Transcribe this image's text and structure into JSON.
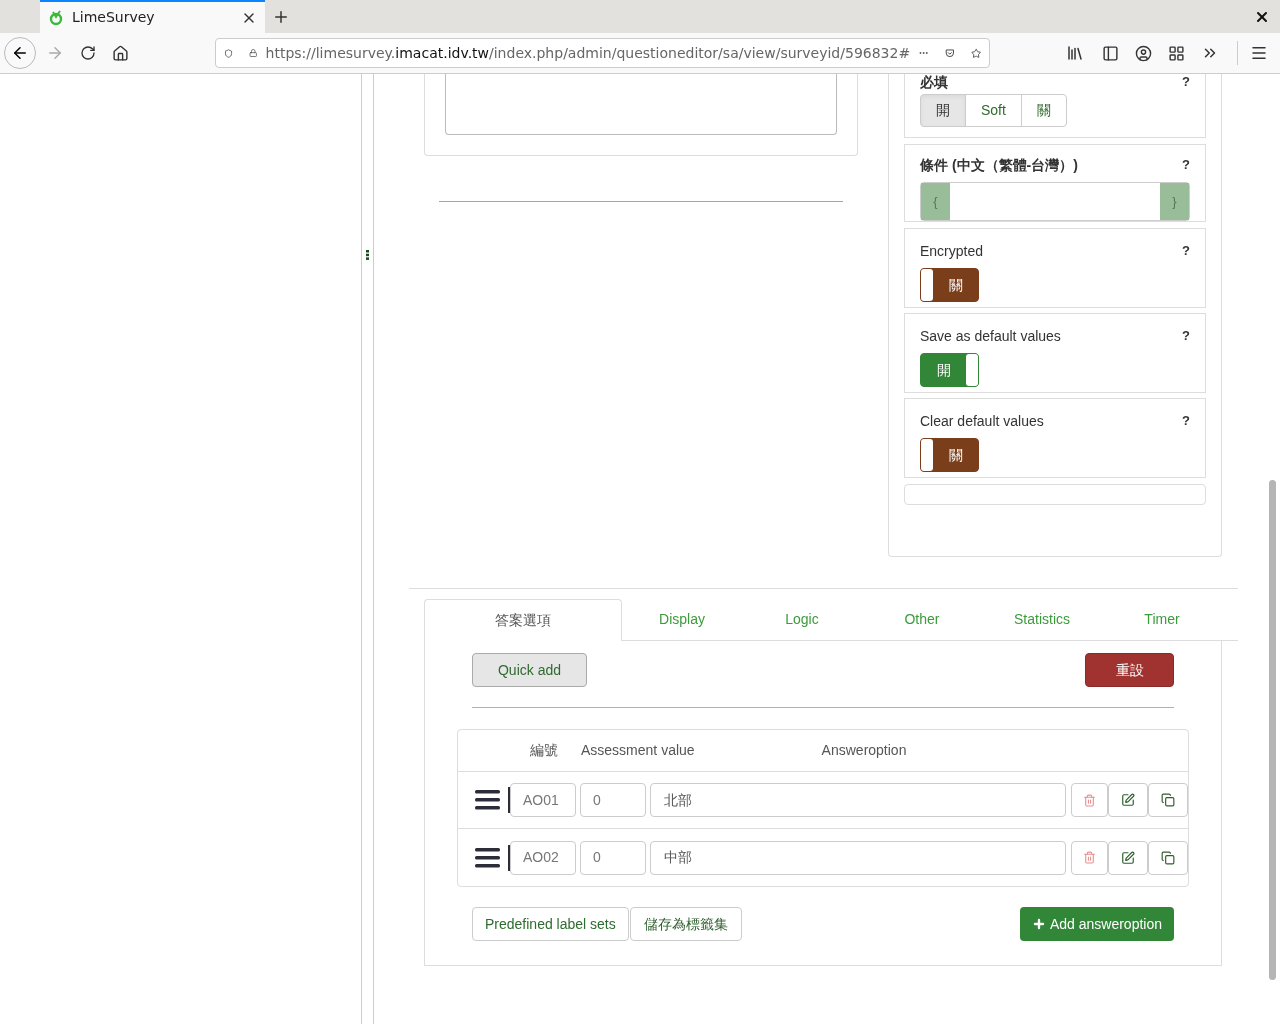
{
  "browser": {
    "tab_title": "LimeSurvey",
    "url": {
      "prefix": "https://limesurvey.",
      "domain": "imacat.idv.tw",
      "path": "/index.php/admin/questioneditor/sa/view/surveyid/596832#"
    }
  },
  "mandatory": {
    "label": "必填",
    "help": "?",
    "options": [
      {
        "label": "開",
        "selected": true
      },
      {
        "label": "Soft",
        "selected": false
      },
      {
        "label": "關",
        "selected": false
      }
    ]
  },
  "condition": {
    "label": "條件 (中文（繁體-台灣）)",
    "help": "?",
    "prefix": "{",
    "suffix": "}"
  },
  "switches": [
    {
      "label": "Encrypted",
      "help": "?",
      "on": false,
      "text": "關"
    },
    {
      "label": "Save as default values",
      "help": "?",
      "on": true,
      "text": "開"
    },
    {
      "label": "Clear default values",
      "help": "?",
      "on": false,
      "text": "關"
    }
  ],
  "tabs": [
    {
      "label": "答案選項",
      "selected": true
    },
    {
      "label": "Display",
      "selected": false
    },
    {
      "label": "Logic",
      "selected": false
    },
    {
      "label": "Other",
      "selected": false
    },
    {
      "label": "Statistics",
      "selected": false
    },
    {
      "label": "Timer",
      "selected": false
    }
  ],
  "toolbar": {
    "quick_add": "Quick add",
    "reset": "重設"
  },
  "table": {
    "columns": [
      "編號",
      "Assessment value",
      "Answeroption"
    ],
    "rows": [
      {
        "code": "AO01",
        "assessment": "0",
        "answer": "北部"
      },
      {
        "code": "AO02",
        "assessment": "0",
        "answer": "中部"
      }
    ]
  },
  "footer": {
    "predefined": "Predefined label sets",
    "save_label_set": "儲存為標籤集",
    "add": "Add answeroption"
  }
}
